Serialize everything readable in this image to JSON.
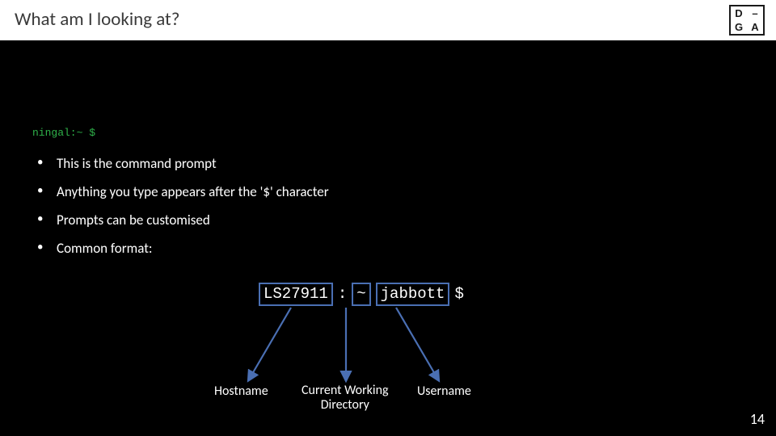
{
  "title": "What am I looking at?",
  "logo": {
    "tl": "D",
    "tr": "–",
    "bl": "G",
    "br": "A"
  },
  "prompt_demo": "ningal:~ $",
  "bullets": [
    "This is the command prompt",
    "Anything you type appears after the '$' character",
    "Prompts can be customised",
    "Common format:"
  ],
  "prompt_parts": {
    "hostname": "LS27911",
    "colon": ":",
    "cwd": "~",
    "username": "jabbott",
    "dollar": "$"
  },
  "labels": {
    "hostname": "Hostname",
    "cwd_line1": "Current Working",
    "cwd_line2": "Directory",
    "username": "Username"
  },
  "page_number": "14"
}
